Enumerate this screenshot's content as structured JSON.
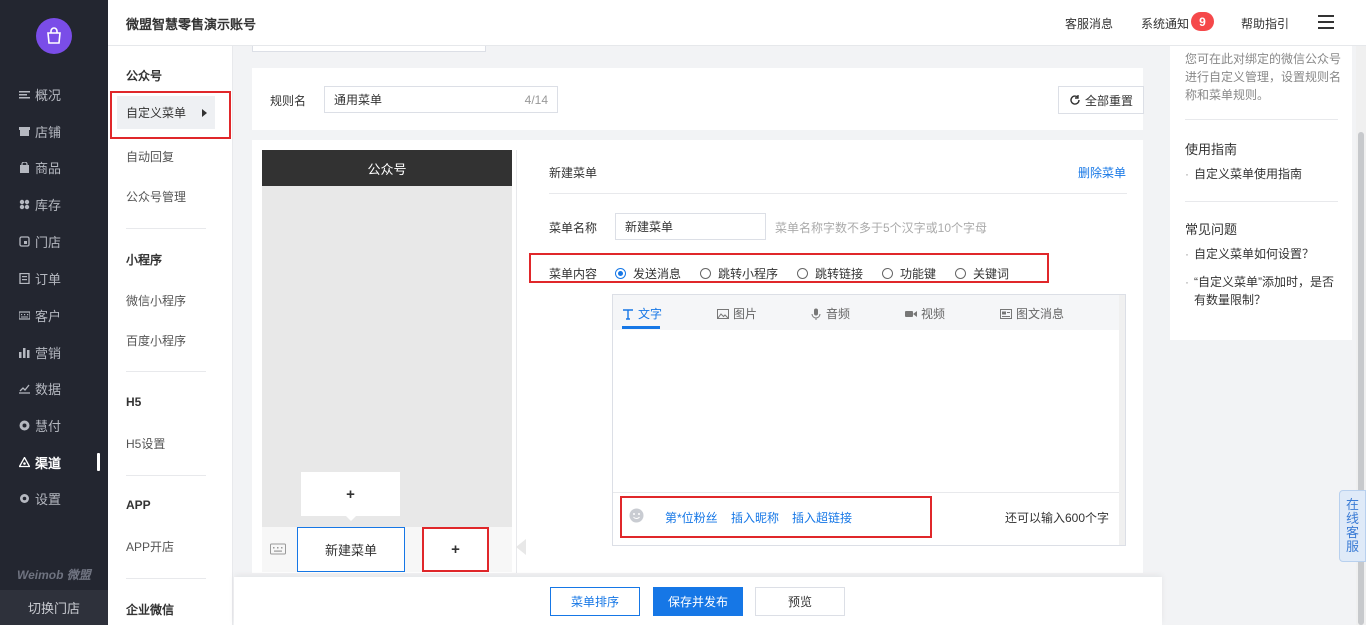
{
  "app": {
    "account_title": "微盟智慧零售演示账号",
    "brand": "Weimob 微盟",
    "switch_store": "切换门店"
  },
  "nav": {
    "items": [
      {
        "label": "概况",
        "icon": "list-icon"
      },
      {
        "label": "店铺",
        "icon": "shop-icon"
      },
      {
        "label": "商品",
        "icon": "bag-icon"
      },
      {
        "label": "库存",
        "icon": "grid-icon"
      },
      {
        "label": "门店",
        "icon": "store-icon"
      },
      {
        "label": "订单",
        "icon": "order-icon"
      },
      {
        "label": "客户",
        "icon": "keyboard-icon"
      },
      {
        "label": "营销",
        "icon": "bar-chart-icon"
      },
      {
        "label": "数据",
        "icon": "line-chart-icon"
      },
      {
        "label": "慧付",
        "icon": "coin-icon"
      },
      {
        "label": "渠道",
        "icon": "channel-icon"
      },
      {
        "label": "设置",
        "icon": "gear-icon"
      }
    ],
    "active": "渠道"
  },
  "header": {
    "links": [
      "客服消息",
      "系统通知",
      "帮助指引"
    ],
    "notice_count": "9"
  },
  "subnav": {
    "groups": [
      {
        "title": "公众号",
        "items": [
          "自定义菜单",
          "自动回复",
          "公众号管理"
        ]
      },
      {
        "title": "小程序",
        "items": [
          "微信小程序",
          "百度小程序"
        ]
      },
      {
        "title": "H5",
        "items": [
          "H5设置"
        ]
      },
      {
        "title": "APP",
        "items": [
          "APP开店"
        ]
      },
      {
        "title": "企业微信",
        "items": []
      }
    ],
    "active": "自定义菜单"
  },
  "rule": {
    "label": "规则名",
    "value": "通用菜单",
    "counter": "4/14",
    "reset_button": "全部重置"
  },
  "phone": {
    "title": "公众号",
    "add_sub": "+",
    "menu_item": "新建菜单",
    "add_menu": "+"
  },
  "editor": {
    "heading": "新建菜单",
    "delete": "删除菜单",
    "name_label": "菜单名称",
    "name_value": "新建菜单",
    "name_hint": "菜单名称字数不多于5个汉字或10个字母",
    "content_label": "菜单内容",
    "content_options": [
      "发送消息",
      "跳转小程序",
      "跳转链接",
      "功能键",
      "关键词"
    ],
    "selected_option": "发送消息",
    "tabs": [
      {
        "label": "文字",
        "icon": "text-icon"
      },
      {
        "label": "图片",
        "icon": "image-icon"
      },
      {
        "label": "音频",
        "icon": "mic-icon"
      },
      {
        "label": "视频",
        "icon": "video-icon"
      },
      {
        "label": "图文消息",
        "icon": "article-icon"
      }
    ],
    "active_tab": "文字",
    "insert_links": [
      "第*位粉丝",
      "插入昵称",
      "插入超链接"
    ],
    "remaining": "还可以输入600个字"
  },
  "help": {
    "desc": "您可在此对绑定的微信公众号进行自定义管理，设置规则名称和菜单规则。",
    "guide_title": "使用指南",
    "guide_items": [
      "自定义菜单使用指南"
    ],
    "faq_title": "常见问题",
    "faq_items": [
      "自定义菜单如何设置？",
      "“自定义菜单”添加时，是否有数量限制？"
    ]
  },
  "footer": {
    "sort_button": "菜单排序",
    "publish_button": "保存并发布",
    "preview_button": "预览"
  },
  "online_service": "在线客服",
  "colors": {
    "nav_bg": "#232630",
    "accent": "#1677e6",
    "badge": "#f5484a",
    "highlight": "#e0272a",
    "logo": "#7a4de8"
  }
}
